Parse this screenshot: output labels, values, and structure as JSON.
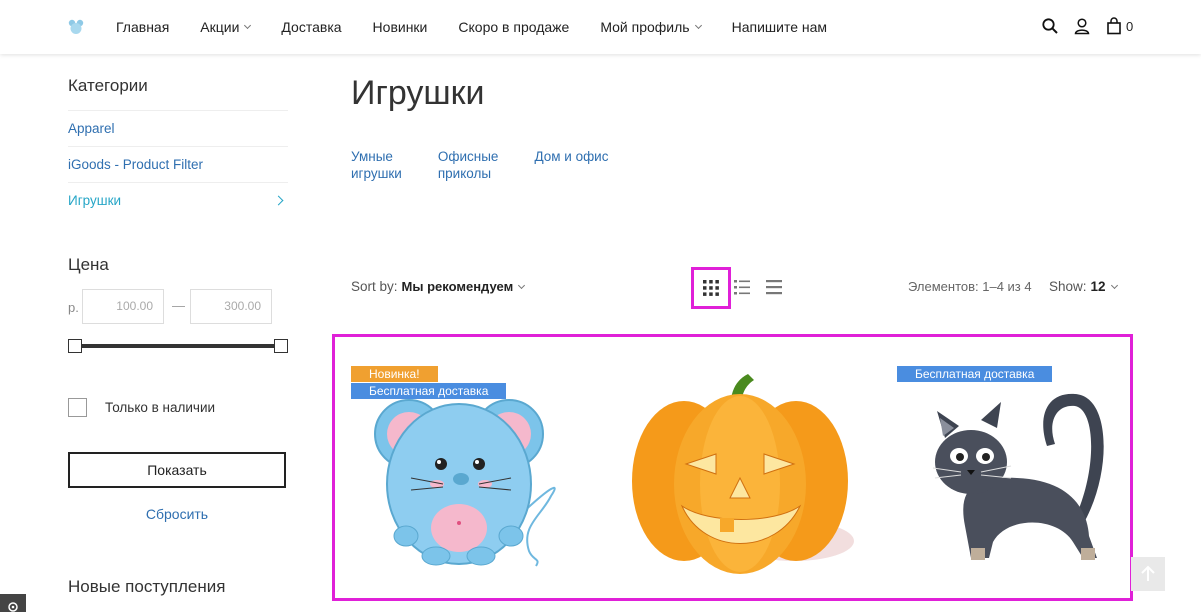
{
  "header": {
    "nav": [
      {
        "label": "Главная",
        "dropdown": false
      },
      {
        "label": "Акции",
        "dropdown": true
      },
      {
        "label": "Доставка",
        "dropdown": false
      },
      {
        "label": "Новинки",
        "dropdown": false
      },
      {
        "label": "Скоро в продаже",
        "dropdown": false
      },
      {
        "label": "Мой профиль",
        "dropdown": true
      },
      {
        "label": "Напишите нам",
        "dropdown": false
      }
    ],
    "cart_count": "0"
  },
  "sidebar": {
    "categories_title": "Категории",
    "categories": [
      {
        "label": "Apparel"
      },
      {
        "label": "iGoods - Product Filter"
      },
      {
        "label": "Игрушки"
      }
    ],
    "price_title": "Цена",
    "currency": "р.",
    "price_min": "100.00",
    "price_max": "300.00",
    "range_fraction": [
      0,
      1
    ],
    "in_stock_label": "Только в наличии",
    "in_stock_checked": false,
    "show_button": "Показать",
    "reset_link": "Сбросить",
    "new_arrivals_title": "Новые поступления"
  },
  "main": {
    "title": "Игрушки",
    "subcategories": [
      {
        "line1": "Умные",
        "line2": "игрушки"
      },
      {
        "line1": "Офисные",
        "line2": "приколы"
      },
      {
        "line1": "Дом и офис",
        "line2": ""
      }
    ],
    "sort_label": "Sort by:",
    "sort_value": "Мы рекомендуем",
    "view_modes": [
      "grid-view-icon",
      "list-view-icon",
      "table-view-icon"
    ],
    "active_view": "grid",
    "elements_text": "Элементов: 1–4 из 4",
    "show_label": "Show:",
    "show_value": "12",
    "products": [
      {
        "name": "mouse",
        "badges": [
          "Новинка!",
          "Бесплатная доставка"
        ]
      },
      {
        "name": "pumpkin",
        "badges": []
      },
      {
        "name": "cat",
        "badges": [
          "Бесплатная доставка"
        ]
      }
    ]
  },
  "colors": {
    "accent_link": "#2f6fb0",
    "active_category": "#27a6c7",
    "highlight": "#e020d8",
    "badge_new": "#f0a030",
    "badge_shipping": "#4a8de0"
  }
}
